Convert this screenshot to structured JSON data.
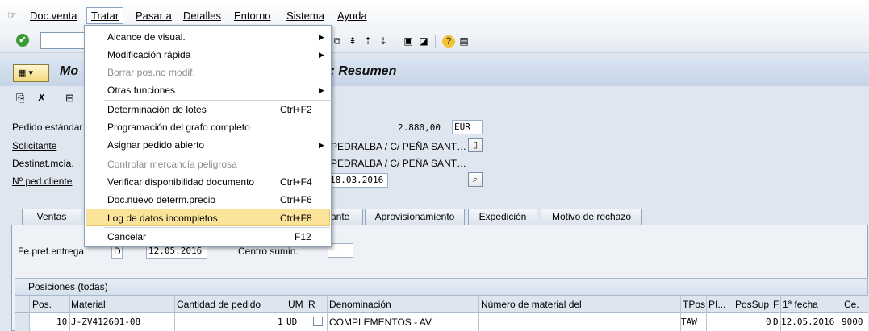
{
  "menubar": {
    "items": [
      "Doc.venta",
      "Tratar",
      "Pasar a",
      "Detalles",
      "Entorno",
      "Sistema",
      "Ayuda"
    ]
  },
  "title": {
    "left": "Mo",
    "right": "D: Resumen"
  },
  "header": {
    "pedido_label": "Pedido estándar",
    "net_value": "2.880,00",
    "currency": "EUR",
    "solicitante_label": "Solicitante",
    "solicitante_value": "PEDRALBA / C/ PEÑA SANT…",
    "destinat_label": "Destinat.mcía.",
    "destinat_value": "PEDRALBA / C/ PEÑA SANT…",
    "ped_cliente_label": "Nº ped.cliente",
    "ped_cliente_date": "18.03.2016"
  },
  "tabs": [
    "Ventas",
    "ante",
    "Aprovisionamiento",
    "Expedición",
    "Motivo de rechazo"
  ],
  "delivery": {
    "fe_pref_label": "Fe.pref.entrega",
    "fe_pref_unit": "D",
    "fe_pref_date": "12.05.2016",
    "centro_label": "Centro sumin."
  },
  "grid": {
    "title": "Posiciones (todas)",
    "headers": [
      "Pos.",
      "Material",
      "Cantidad de pedido",
      "UM",
      "R",
      "Denominación",
      "Número de material del",
      "TPos",
      "PI...",
      "PosSup",
      "F",
      "1ª fecha",
      "Ce."
    ],
    "row": {
      "pos": "10",
      "material": "J-ZV412601-08",
      "cantidad": "1",
      "um": "UD",
      "denominacion": "COMPLEMENTOS - AV",
      "tpos": "TAW",
      "possup": "0",
      "f": "D",
      "fecha": "12.05.2016",
      "ce": "9000"
    }
  },
  "dropdown": {
    "items": [
      {
        "label": "Alcance de visual.",
        "submenu": true
      },
      {
        "label": "Modificación rápida",
        "submenu": true
      },
      {
        "label": "Borrar pos.no modif.",
        "disabled": true
      },
      {
        "label": "Otras funciones",
        "submenu": true
      },
      {
        "label": "Determinación de lotes",
        "shortcut": "Ctrl+F2"
      },
      {
        "label": "Programación del grafo completo"
      },
      {
        "label": "Asignar pedido abierto",
        "submenu": true
      },
      {
        "label": "Controlar mercancía peligrosa",
        "disabled": true
      },
      {
        "label": "Verificar disponibilidad documento",
        "shortcut": "Ctrl+F4"
      },
      {
        "label": "Doc.nuevo determ.precio",
        "shortcut": "Ctrl+F6"
      },
      {
        "label": "Log de datos incompletos",
        "shortcut": "Ctrl+F8",
        "highlighted": true
      },
      {
        "label": "Cancelar",
        "shortcut": "F12"
      }
    ]
  }
}
